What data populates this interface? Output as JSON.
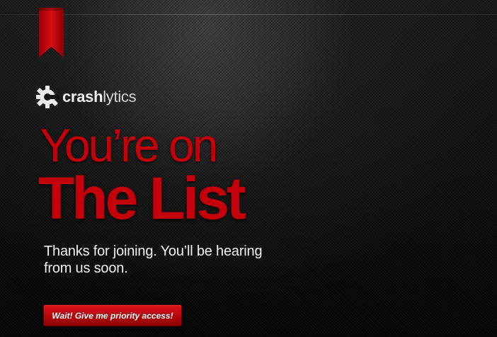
{
  "brand": {
    "name_bold": "crash",
    "name_light": "lytics",
    "logo_icon": "gear-c-icon",
    "ribbon_icon": "bookmark-ribbon-icon"
  },
  "headline": {
    "line1": "You’re on",
    "line2": "The List"
  },
  "message": "Thanks for joining. You’ll be hearing from us soon.",
  "cta": {
    "label": "Wait! Give me priority access!"
  },
  "colors": {
    "accent_red": "#c4000a",
    "background": "#111111",
    "text": "#f1f1f1"
  }
}
